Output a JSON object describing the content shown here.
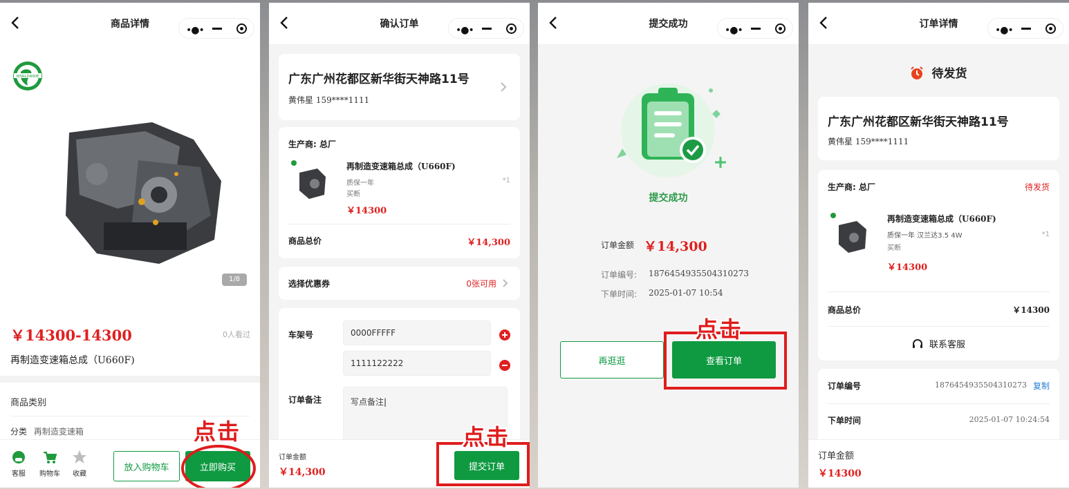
{
  "colors": {
    "accent": "#0f9a41",
    "price": "#e02020",
    "highlight": "#e01c1c"
  },
  "click_hint": "点击",
  "p1": {
    "nav_title": "商品详情",
    "brand_logo": "WSRLDWIDE",
    "page_indicator": "1/8",
    "price": "￥14300-14300",
    "views": "0人看过",
    "product_name": "再制造变速箱总成（U660F)",
    "category_label": "商品类别",
    "sub_category_key": "分类",
    "sub_category_value": "再制造变速箱",
    "bottom": {
      "service": "客服",
      "cart": "购物车",
      "favorite": "收藏",
      "add_cart": "放入购物车",
      "buy_now": "立即购买"
    }
  },
  "p2": {
    "nav_title": "确认订单",
    "address": "广东广州花都区新华街天神路11号",
    "contact": "黄伟星 159****1111",
    "manufacturer": "生产商: 总厂",
    "item_name": "再制造变速箱总成（U660F)",
    "item_spec1": "质保一年",
    "item_spec2": "买断",
    "item_qty": "*1",
    "item_price": "￥14300",
    "subtotal_label": "商品总价",
    "subtotal_value": "￥14,300",
    "coupon_label": "选择优惠券",
    "coupon_value": "0张可用",
    "frame_label": "车架号",
    "frame1": "0000FFFFF",
    "frame2": "1111122222",
    "remark_label": "订单备注",
    "remark_placeholder": "写点备注",
    "total_label": "订单金额",
    "total_value": "￥14,300",
    "submit": "提交订单"
  },
  "p3": {
    "nav_title": "提交成功",
    "success_text": "提交成功",
    "amount_label": "订单金额",
    "amount_value": "￥14,300",
    "order_no_label": "订单编号:",
    "order_no": "1876454935504310273",
    "time_label": "下单时间:",
    "time": "2025-01-07 10:54",
    "continue": "再逛逛",
    "view_order": "查看订单"
  },
  "p4": {
    "nav_title": "订单详情",
    "status": "待发货",
    "address": "广东广州花都区新华街天神路11号",
    "contact": "黄伟星 159****1111",
    "manufacturer": "生产商: 总厂",
    "manufacturer_status": "待发货",
    "item_name": "再制造变速箱总成（U660F)",
    "item_spec1": "质保一年 汉兰达3.5 4W",
    "item_spec2": "买断",
    "item_qty": "*1",
    "item_price": "￥14300",
    "subtotal_label": "商品总价",
    "subtotal_value": "￥14300",
    "service": "联系客服",
    "order_no_label": "订单编号",
    "order_no": "1876454935504310273",
    "copy": "复制",
    "time_label": "下单时间",
    "time": "2025-01-07 10:24:54",
    "total_label": "订单金额",
    "total_value": "￥14300"
  }
}
